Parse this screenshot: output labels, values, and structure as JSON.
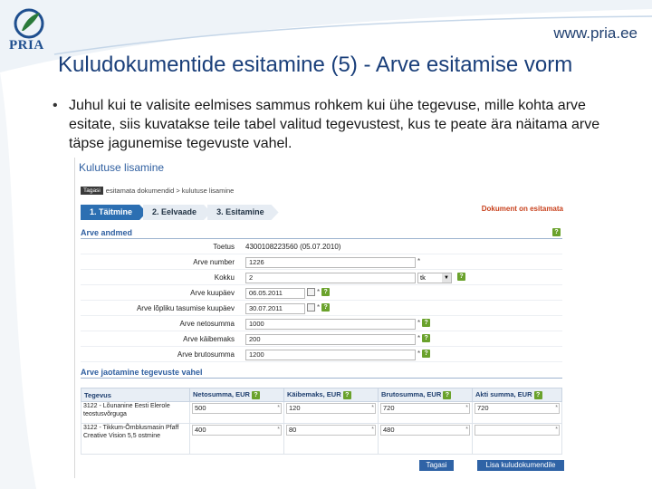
{
  "slide": {
    "logo_text": "PRIA",
    "site_url": "www.pria.ee",
    "title": "Kuludokumentide esitamine (5) - Arve esitamise vorm",
    "bullet_symbol": "•",
    "bullet": "Juhul kui te valisite eelmises sammus rohkem kui ühe tegevuse, mille kohta arve esitate, siis kuvatakse teile tabel valitud tegevustest, kus te peate ära näitama arve täpse jagunemise tegevuste vahel."
  },
  "app": {
    "page_title": "Kulutuse lisamine",
    "breadcrumb": {
      "tag": "Tagasi",
      "path": "esitamata dokumendid > kulutuse lisamine"
    },
    "steps": [
      {
        "label": "1. Täitmine",
        "active": true
      },
      {
        "label": "2. Eelvaade",
        "active": false
      },
      {
        "label": "3. Esitamine",
        "active": false
      }
    ],
    "document_status": "Dokument on esitamata",
    "invoice_section": {
      "title": "Arve andmed",
      "rows": [
        {
          "label": "Toetus",
          "value": "4300108223560 (05.07.2010)"
        },
        {
          "label": "Arve number",
          "value": "1226"
        },
        {
          "label": "Kokku",
          "value": "2",
          "unit": "tk"
        },
        {
          "label": "Arve kuupäev",
          "value": "06.05.2011"
        },
        {
          "label": "Arve lõpliku tasumise kuupäev",
          "value": "30.07.2011"
        },
        {
          "label": "Arve netosumma",
          "value": "1000"
        },
        {
          "label": "Arve käibemaks",
          "value": "200"
        },
        {
          "label": "Arve brutosumma",
          "value": "1200"
        }
      ]
    },
    "distribution_section": {
      "title": "Arve jaotamine tegevuste vahel",
      "columns": [
        "Tegevus",
        "Netosumma, EUR",
        "Käibemaks, EUR",
        "Brutosumma, EUR",
        "Akti summa, EUR"
      ],
      "rows": [
        {
          "tegevus": "3122 - Lõunanine Eesti Elerole teostusvõrguga",
          "net": "500",
          "vat": "120",
          "gross": "720",
          "act": "720"
        },
        {
          "tegevus": "3122 - Tikkum-Õmblusmasin Pfaff Creative Vision 5,5 ostmine",
          "net": "400",
          "vat": "80",
          "gross": "480",
          "act": ""
        }
      ]
    },
    "buttons": {
      "back": "Tagasi",
      "add": "Lisa kuludokumendile"
    },
    "help_symbol": "?",
    "required_symbol": "*",
    "dropdown_symbol": "▼",
    "colors": {
      "title_blue": "#1a3f7a",
      "accent_blue": "#2c6fb2",
      "status_red": "#c8421e",
      "help_green": "#6aa22c"
    }
  }
}
